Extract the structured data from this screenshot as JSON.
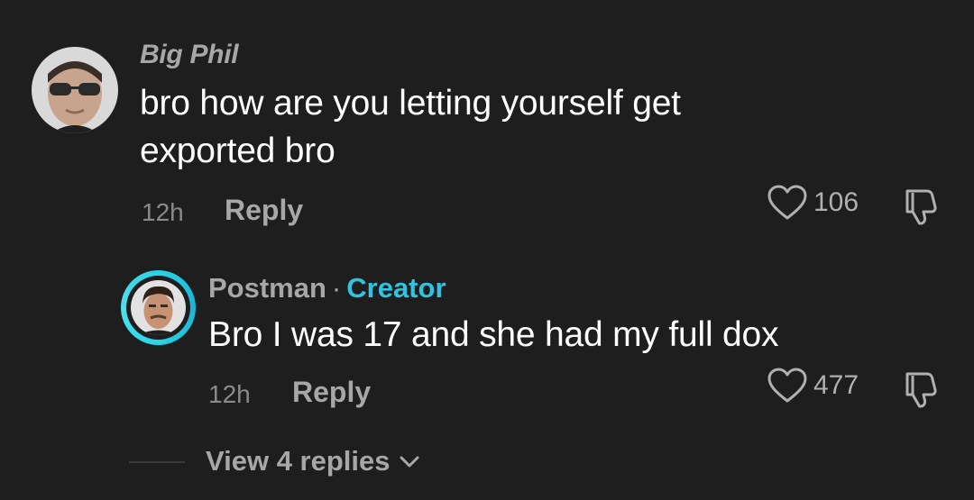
{
  "comment": {
    "username": "Big Phil",
    "text_line1": "bro how are you letting yourself get",
    "text_line2": "exported bro",
    "time": "12h",
    "reply_label": "Reply",
    "likes": "106",
    "avatar_icon": "user-avatar-sunglasses-icon"
  },
  "reply": {
    "username": "Postman",
    "separator": "·",
    "badge": "Creator",
    "text": "Bro I was 17 and she had my full dox",
    "time": "12h",
    "reply_label": "Reply",
    "likes": "477",
    "avatar_icon": "creator-avatar-icon",
    "ring_color": "#28d4e6"
  },
  "view_replies": {
    "label": "View 4 replies"
  },
  "colors": {
    "background": "#1e1e1e",
    "accent": "#2fc3e0",
    "muted_text": "#a7a7a7"
  }
}
